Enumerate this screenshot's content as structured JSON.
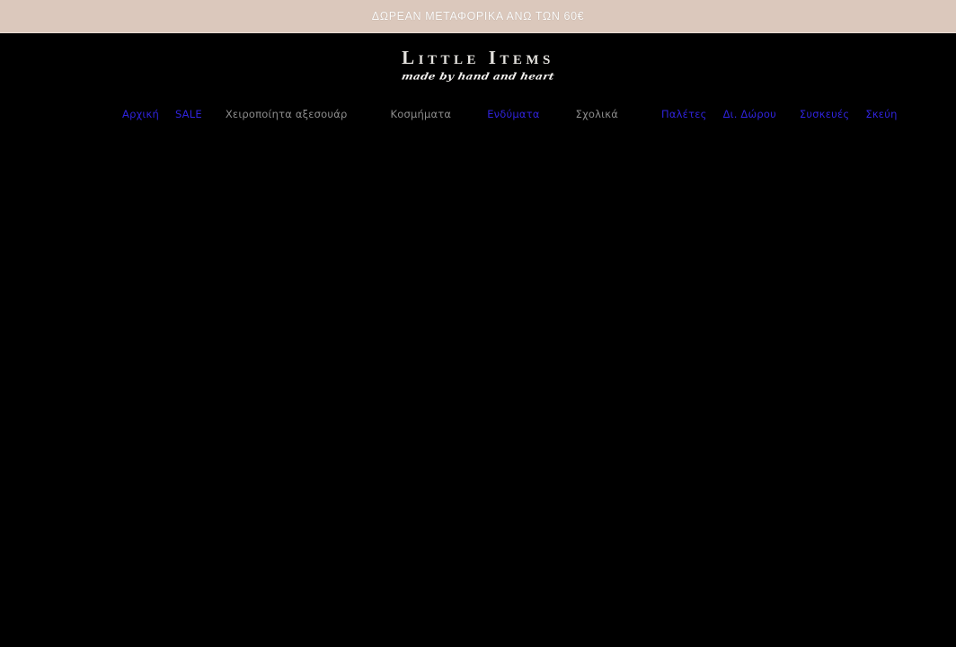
{
  "promo": {
    "text": "ΔΩΡΕΑΝ ΜΕΤΑΦΟΡΙΚΑ ΑΝΩ ΤΩΝ 60€"
  },
  "logo": {
    "wordmark": "Little Items",
    "tagline": "made by hand and heart"
  },
  "nav": {
    "items": [
      {
        "label": "Αρχική",
        "style": "accent"
      },
      {
        "label": "SALE",
        "style": "accent"
      },
      {
        "label": "Χειροποίητα αξεσουάρ",
        "style": "muted"
      },
      {
        "label": "Κοσμήματα",
        "style": "muted"
      },
      {
        "label": "Ενδύματα",
        "style": "accent"
      },
      {
        "label": "Σχολικά",
        "style": "muted"
      },
      {
        "label": "Παλέτες",
        "style": "accent"
      },
      {
        "label": "Δι. Δώρου",
        "style": "accent"
      },
      {
        "label": "Συσκευές",
        "style": "accent"
      },
      {
        "label": "Σκεύη",
        "style": "accent"
      }
    ]
  },
  "colors": {
    "banner_background": "#dbc8bc",
    "banner_text": "#fdfcfb",
    "page_background": "#000000",
    "nav_accent": "#3a2fd0",
    "nav_muted": "#8b8b8b",
    "logo_text": "#e4e2de"
  }
}
